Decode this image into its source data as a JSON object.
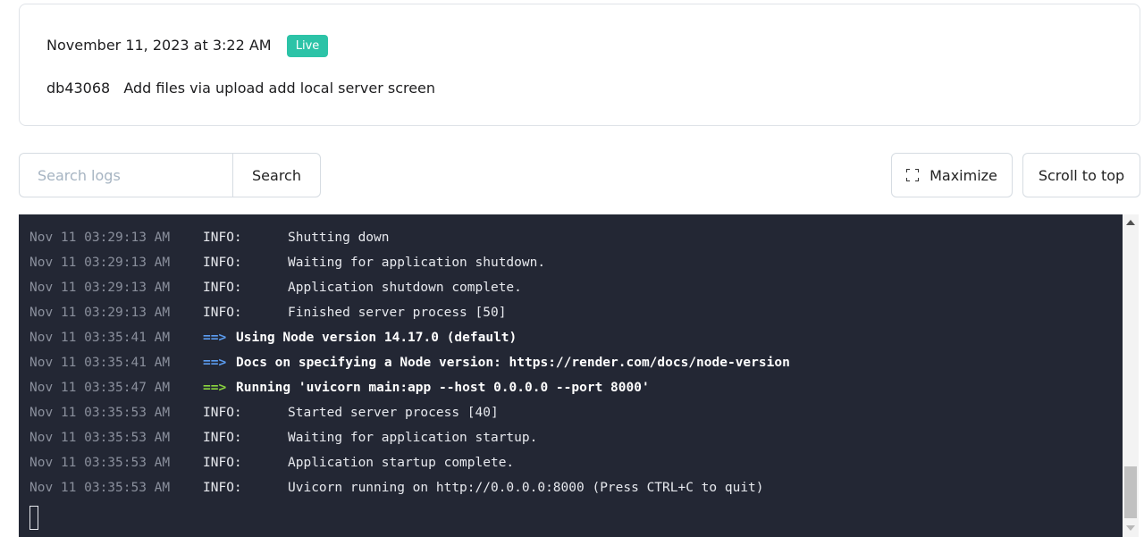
{
  "deploy": {
    "date": "November 11, 2023 at 3:22 AM",
    "status": "Live",
    "commit_hash": "db43068",
    "commit_message": "Add files via upload add local server screen"
  },
  "colors": {
    "live_badge": "#2cc3a7",
    "log_background": "#232734",
    "arrow_blue": "#5b9cf0",
    "arrow_green": "#8ad33f"
  },
  "toolbar": {
    "search_placeholder": "Search logs",
    "search_label": "Search",
    "maximize_label": "Maximize",
    "maximize_icon": "maximize-icon",
    "scroll_top_label": "Scroll to top"
  },
  "logs": [
    {
      "ts": "Nov 11 03:29:13 AM",
      "level": "INFO:",
      "msg": "Shutting down"
    },
    {
      "ts": "Nov 11 03:29:13 AM",
      "level": "INFO:",
      "msg": "Waiting for application shutdown."
    },
    {
      "ts": "Nov 11 03:29:13 AM",
      "level": "INFO:",
      "msg": "Application shutdown complete."
    },
    {
      "ts": "Nov 11 03:29:13 AM",
      "level": "INFO:",
      "msg": "Finished server process [50]"
    },
    {
      "ts": "Nov 11 03:35:41 AM",
      "arrow": "==>",
      "arrow_color": "blue",
      "msg": "Using Node version 14.17.0 (default)"
    },
    {
      "ts": "Nov 11 03:35:41 AM",
      "arrow": "==>",
      "arrow_color": "blue",
      "msg": "Docs on specifying a Node version: https://render.com/docs/node-version"
    },
    {
      "ts": "Nov 11 03:35:47 AM",
      "arrow": "==>",
      "arrow_color": "green",
      "msg": "Running 'uvicorn main:app --host 0.0.0.0 --port 8000'"
    },
    {
      "ts": "Nov 11 03:35:53 AM",
      "level": "INFO:",
      "msg": "Started server process [40]"
    },
    {
      "ts": "Nov 11 03:35:53 AM",
      "level": "INFO:",
      "msg": "Waiting for application startup."
    },
    {
      "ts": "Nov 11 03:35:53 AM",
      "level": "INFO:",
      "msg": "Application startup complete."
    },
    {
      "ts": "Nov 11 03:35:53 AM",
      "level": "INFO:",
      "msg": "Uvicorn running on http://0.0.0.0:8000 (Press CTRL+C to quit)"
    }
  ]
}
